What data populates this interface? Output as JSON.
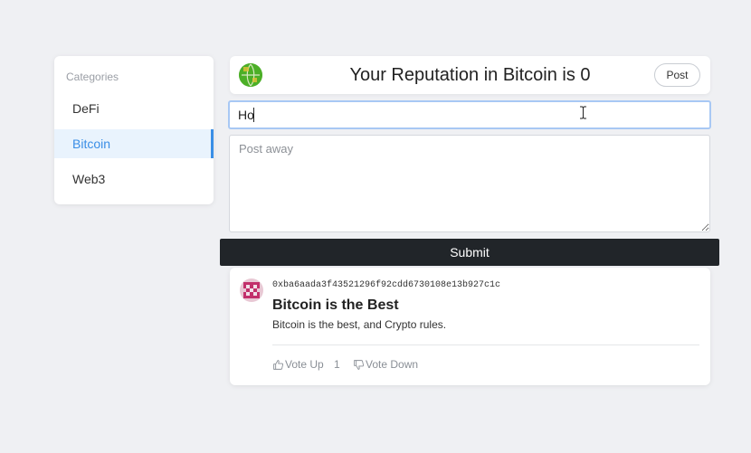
{
  "sidebar": {
    "title": "Categories",
    "items": [
      {
        "label": "DeFi"
      },
      {
        "label": "Bitcoin"
      },
      {
        "label": "Web3"
      }
    ]
  },
  "header": {
    "title": "Your Reputation in Bitcoin is 0",
    "post_button": "Post",
    "globe_icon": "globe-icon",
    "globe_color": "#4caf27"
  },
  "form": {
    "title_value": "Ho",
    "textarea_placeholder": "Post away",
    "submit_label": "Submit"
  },
  "posts": [
    {
      "author": "0xba6aada3f43521296f92cdd6730108e13b927c1c",
      "title": "Bitcoin is the Best",
      "body": "Bitcoin is the best, and Crypto rules.",
      "vote_up_label": "Vote Up",
      "vote_count": "1",
      "vote_down_label": "Vote Down"
    }
  ],
  "colors": {
    "accent": "#3a8ee6",
    "submit_bg": "#212529",
    "page_bg": "#eff0f3"
  }
}
